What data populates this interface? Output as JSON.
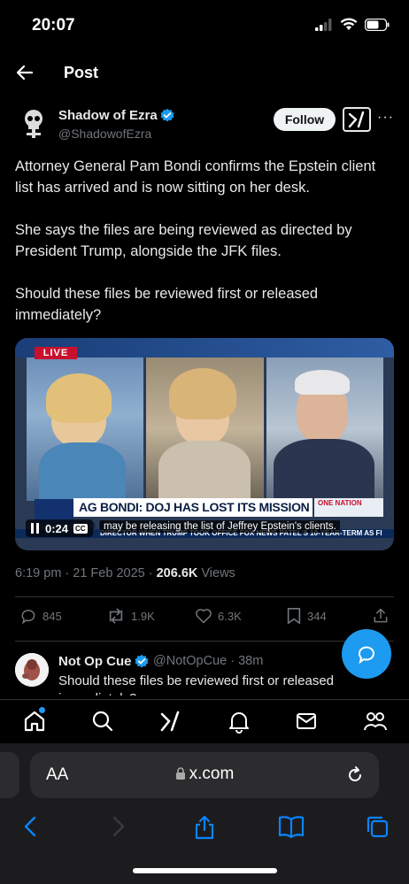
{
  "status_bar": {
    "time": "20:07"
  },
  "header": {
    "title": "Post"
  },
  "author": {
    "name": "Shadow of Ezra",
    "handle": "@ShadowofEzra",
    "follow_label": "Follow"
  },
  "post": {
    "paragraphs": [
      "Attorney General Pam Bondi confirms the Epstein client list has arrived and is now sitting on her desk.",
      "She says the files are being reviewed as directed by President Trump, alongside the JFK files.",
      "Should these files be reviewed first or released immediately?"
    ],
    "timestamp": "6:19 pm · 21 Feb 2025 · ",
    "views_count": "206.6K",
    "views_label": " Views"
  },
  "media": {
    "live_label": "LIVE",
    "chyron": "AG BONDI: DOJ HAS LOST ITS MISSION TO FIGHT CRIME",
    "chyron_side": "ONE NATION",
    "ticker": "DIRECTOR WHEN TRUMP TOOK OFFICE   FOX NEWS  PATEL'S 10-YEAR-TERM AS FI",
    "video_time": "0:24",
    "cc_label": "CC",
    "caption": "may be releasing the list of Jeffrey Epstein's clients."
  },
  "actions": {
    "replies": "845",
    "reposts": "1.9K",
    "likes": "6.3K",
    "bookmarks": "344"
  },
  "reply": {
    "name": "Not Op Cue",
    "handle": "@NotOpCue · 38m",
    "text": "Should these files be reviewed first or released immediately?"
  },
  "browser": {
    "aa_label": "AA",
    "url": "x.com"
  },
  "colors": {
    "accent": "#1d9bf0",
    "background": "#000000",
    "secondary_text": "#71767b"
  }
}
